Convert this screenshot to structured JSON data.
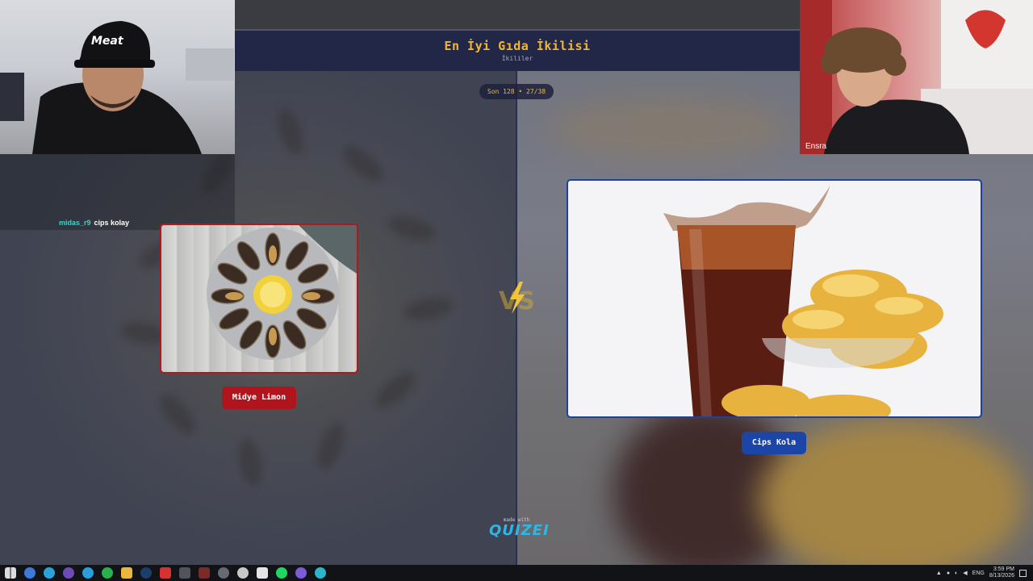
{
  "quiz": {
    "title": "En İyi Gıda İkilisi",
    "subtitle": "İkililer",
    "progress": "Son 128 • 27/38"
  },
  "choices": [
    {
      "label": "Midye Limon",
      "color": "#b0141c",
      "image": "stuffed-mussels-plate"
    },
    {
      "label": "Cips Kola",
      "color": "#1c45a8",
      "image": "cola-and-chips"
    }
  ],
  "vs_icon": "vs-lightning-icon",
  "branding": {
    "made_with": "made with",
    "logo": "QUIZEI"
  },
  "webcams": {
    "right_name": "Ensra"
  },
  "chat": {
    "user": "midas_r9",
    "message": "cips kolay"
  },
  "taskbar": {
    "icons": [
      "windows-start-icon",
      "search-icon",
      "edge-icon",
      "obs-icon",
      "telegram-icon",
      "whatsapp-icon",
      "file-explorer-icon",
      "steam-icon",
      "pdf-icon",
      "app-icon",
      "app-icon-2",
      "settings-icon",
      "chrome-icon",
      "game-icon",
      "spotify-icon",
      "discord-icon",
      "browser-icon"
    ],
    "language": "ENG",
    "time": "3:59 PM",
    "date": "8/13/2026"
  }
}
